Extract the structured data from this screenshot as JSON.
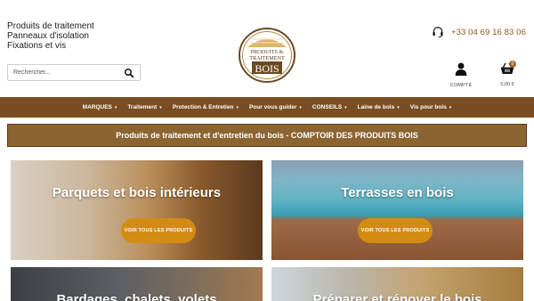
{
  "taglines": [
    "Produits de traitement",
    "Panneaux d'isolation",
    "Fixations et vis"
  ],
  "search": {
    "placeholder": "Rechercher..."
  },
  "logo": {
    "line1": "PRODUITS &",
    "line2": "TRAITEMENT",
    "line3": "BOIS"
  },
  "phone": "+33 04 69 16 83 06",
  "account": {
    "label": "COMPTE"
  },
  "cart": {
    "label": "0,00 €",
    "count": "0"
  },
  "nav": [
    {
      "label": "MARQUES"
    },
    {
      "label": "Traitement"
    },
    {
      "label": "Protection & Entretien"
    },
    {
      "label": "Pour vous guider"
    },
    {
      "label": "CONSEILS"
    },
    {
      "label": "Laine de bois"
    },
    {
      "label": "Vis pour bois"
    }
  ],
  "banner": "Produits de traitement et d'entretien du bois - COMPTOIR DES PRODUITS BOIS",
  "tiles": [
    {
      "title": "Parquets et bois intérieurs",
      "button": "VOIR TOUS LES PRODUITS"
    },
    {
      "title": "Terrasses en bois",
      "button": "VOIR TOUS LES PRODUITS"
    },
    {
      "title": "Bardages, chalets, volets"
    },
    {
      "title": "Préparer et rénover le bois"
    }
  ],
  "colors": {
    "nav": "#7a4e22",
    "banner": "#8b6431",
    "button": "#d38c12",
    "phone": "#8a5a1c"
  }
}
